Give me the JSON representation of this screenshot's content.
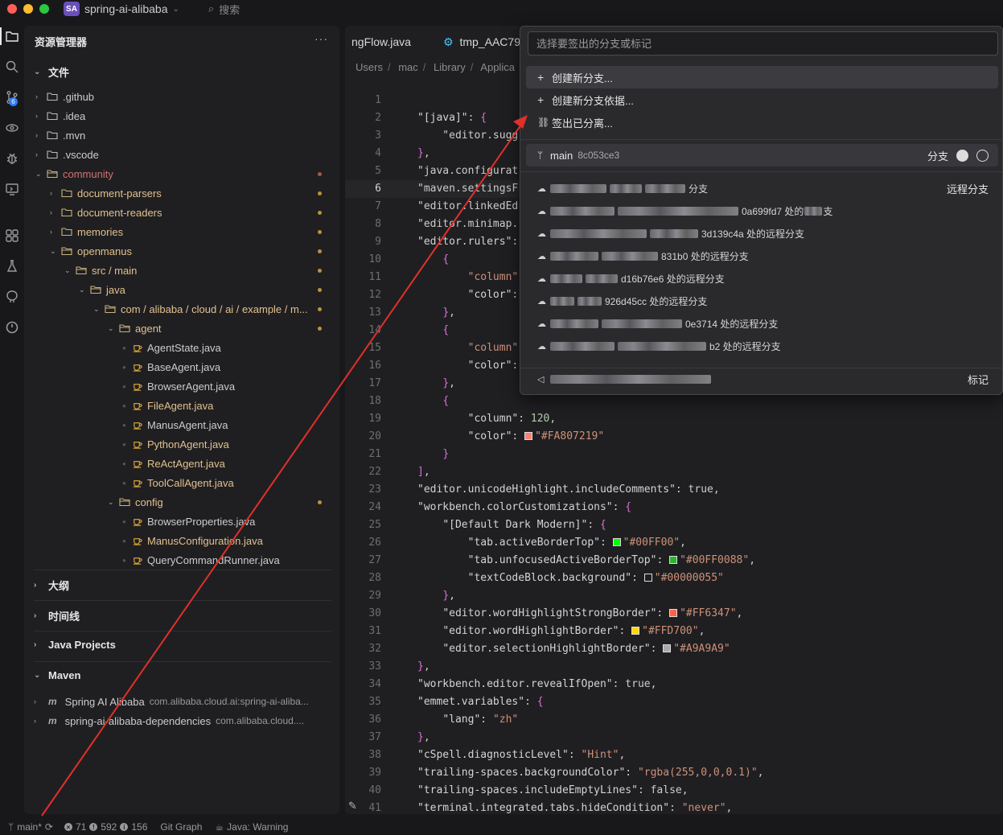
{
  "titlebar": {
    "project_badge": "SA",
    "project_name": "spring-ai-alibaba",
    "search_label": "搜索"
  },
  "sidebar": {
    "header": "资源管理器",
    "more": "···",
    "files_section": "文件",
    "tree": [
      {
        "label": ".github",
        "depth": 0,
        "kind": "folder",
        "modified": false
      },
      {
        "label": ".idea",
        "depth": 0,
        "kind": "folder",
        "modified": false
      },
      {
        "label": ".mvn",
        "depth": 0,
        "kind": "folder",
        "modified": false
      },
      {
        "label": ".vscode",
        "depth": 0,
        "kind": "folder",
        "modified": false
      },
      {
        "label": "community",
        "depth": 0,
        "kind": "folder-open",
        "modified": true,
        "red": true
      },
      {
        "label": "document-parsers",
        "depth": 1,
        "kind": "folder",
        "modified": true
      },
      {
        "label": "document-readers",
        "depth": 1,
        "kind": "folder",
        "modified": true
      },
      {
        "label": "memories",
        "depth": 1,
        "kind": "folder",
        "modified": true
      },
      {
        "label": "openmanus",
        "depth": 1,
        "kind": "folder-open",
        "modified": true
      },
      {
        "label": "src / main",
        "depth": 2,
        "kind": "folder-open",
        "modified": true
      },
      {
        "label": "java",
        "depth": 3,
        "kind": "folder-open",
        "modified": true
      },
      {
        "label": "com / alibaba / cloud / ai / example / m...",
        "depth": 4,
        "kind": "folder-open",
        "modified": true
      },
      {
        "label": "agent",
        "depth": 5,
        "kind": "folder-open",
        "modified": true
      },
      {
        "label": "AgentState.java",
        "depth": 6,
        "kind": "java",
        "modified": false
      },
      {
        "label": "BaseAgent.java",
        "depth": 6,
        "kind": "java",
        "modified": false
      },
      {
        "label": "BrowserAgent.java",
        "depth": 6,
        "kind": "java",
        "modified": false
      },
      {
        "label": "FileAgent.java",
        "depth": 6,
        "kind": "java",
        "modified": true
      },
      {
        "label": "ManusAgent.java",
        "depth": 6,
        "kind": "java",
        "modified": false
      },
      {
        "label": "PythonAgent.java",
        "depth": 6,
        "kind": "java",
        "modified": true
      },
      {
        "label": "ReActAgent.java",
        "depth": 6,
        "kind": "java",
        "modified": true
      },
      {
        "label": "ToolCallAgent.java",
        "depth": 6,
        "kind": "java",
        "modified": true
      },
      {
        "label": "config",
        "depth": 5,
        "kind": "folder-open",
        "modified": true
      },
      {
        "label": "BrowserProperties.java",
        "depth": 6,
        "kind": "java",
        "modified": false
      },
      {
        "label": "ManusConfiguration.java",
        "depth": 6,
        "kind": "java",
        "modified": true
      },
      {
        "label": "QueryCommandRunner.java",
        "depth": 6,
        "kind": "java",
        "modified": false
      }
    ],
    "sections": [
      "大纲",
      "时间线",
      "Java Projects",
      "Maven"
    ],
    "maven": [
      {
        "name": "Spring AI Alibaba",
        "sub": "com.alibaba.cloud.ai:spring-ai-aliba..."
      },
      {
        "name": "spring-ai-alibaba-dependencies",
        "sub": "com.alibaba.cloud...."
      }
    ]
  },
  "editor": {
    "tabs": [
      "ngFlow.java",
      "tmp_AAC79"
    ],
    "breadcrumb": [
      "Users",
      "mac",
      "Library",
      "Applica"
    ],
    "current_line": 6,
    "lines": [
      "",
      "\"[java]\": {",
      "    \"editor.sugg",
      "},",
      "\"java.configurat",
      "\"maven.settingsF",
      "\"editor.linkedEd",
      "\"editor.minimap.",
      "\"editor.rulers\":",
      "    {",
      "        \"column\"",
      "        \"color\":",
      "    },",
      "    {",
      "        \"column\"",
      "        \"color\":",
      "    },",
      "    {",
      "        \"column\": 120,",
      "        \"color\": \"#FA807219\"",
      "    }",
      "],",
      "\"editor.unicodeHighlight.includeComments\": true,",
      "\"workbench.colorCustomizations\": {",
      "    \"[Default Dark Modern]\": {",
      "        \"tab.activeBorderTop\": \"#00FF00\",",
      "        \"tab.unfocusedActiveBorderTop\": \"#00FF0088\",",
      "        \"textCodeBlock.background\": \"#00000055\"",
      "    },",
      "    \"editor.wordHighlightStrongBorder\": \"#FF6347\",",
      "    \"editor.wordHighlightBorder\": \"#FFD700\",",
      "    \"editor.selectionHighlightBorder\": \"#A9A9A9\"",
      "},",
      "\"workbench.editor.revealIfOpen\": true,",
      "\"emmet.variables\": {",
      "    \"lang\": \"zh\"",
      "},",
      "\"cSpell.diagnosticLevel\": \"Hint\",",
      "\"trailing-spaces.backgroundColor\": \"rgba(255,0,0,0.1)\",",
      "\"trailing-spaces.includeEmptyLines\": false,",
      "\"terminal.integrated.tabs.hideCondition\": \"never\","
    ]
  },
  "picker": {
    "placeholder": "选择要签出的分支或标记",
    "actions": [
      {
        "icon": "plus-icon",
        "label": "创建新分支..."
      },
      {
        "icon": "plus-icon",
        "label": "创建新分支依据..."
      },
      {
        "icon": "unlink-icon",
        "label": "签出已分离..."
      }
    ],
    "current_branch": {
      "name": "main",
      "hash": "8c053ce3",
      "group": "分支"
    },
    "remote_group": "远程分支",
    "remotes": [
      {
        "suffix": "分支"
      },
      {
        "suffix": "0a699fd7 处的",
        "tail": "支"
      },
      {
        "suffix": "3d139c4a 处的远程分支"
      },
      {
        "suffix": "831b0 处的远程分支"
      },
      {
        "suffix": "d16b76e6 处的远程分支"
      },
      {
        "suffix": "926d45cc 处的远程分支"
      },
      {
        "suffix": "0e3714 处的远程分支"
      },
      {
        "suffix": "b2 处的远程分支"
      }
    ],
    "tag_group": "标记"
  },
  "statusbar": {
    "branch": "main*",
    "errors": "71",
    "warnings": "592",
    "infos": "156",
    "git_graph": "Git Graph",
    "java_status": "Java: Warning"
  },
  "colors": {
    "accent": "#2f7cf6",
    "modified": "#e2c08d",
    "annotation": "#e0302a"
  }
}
